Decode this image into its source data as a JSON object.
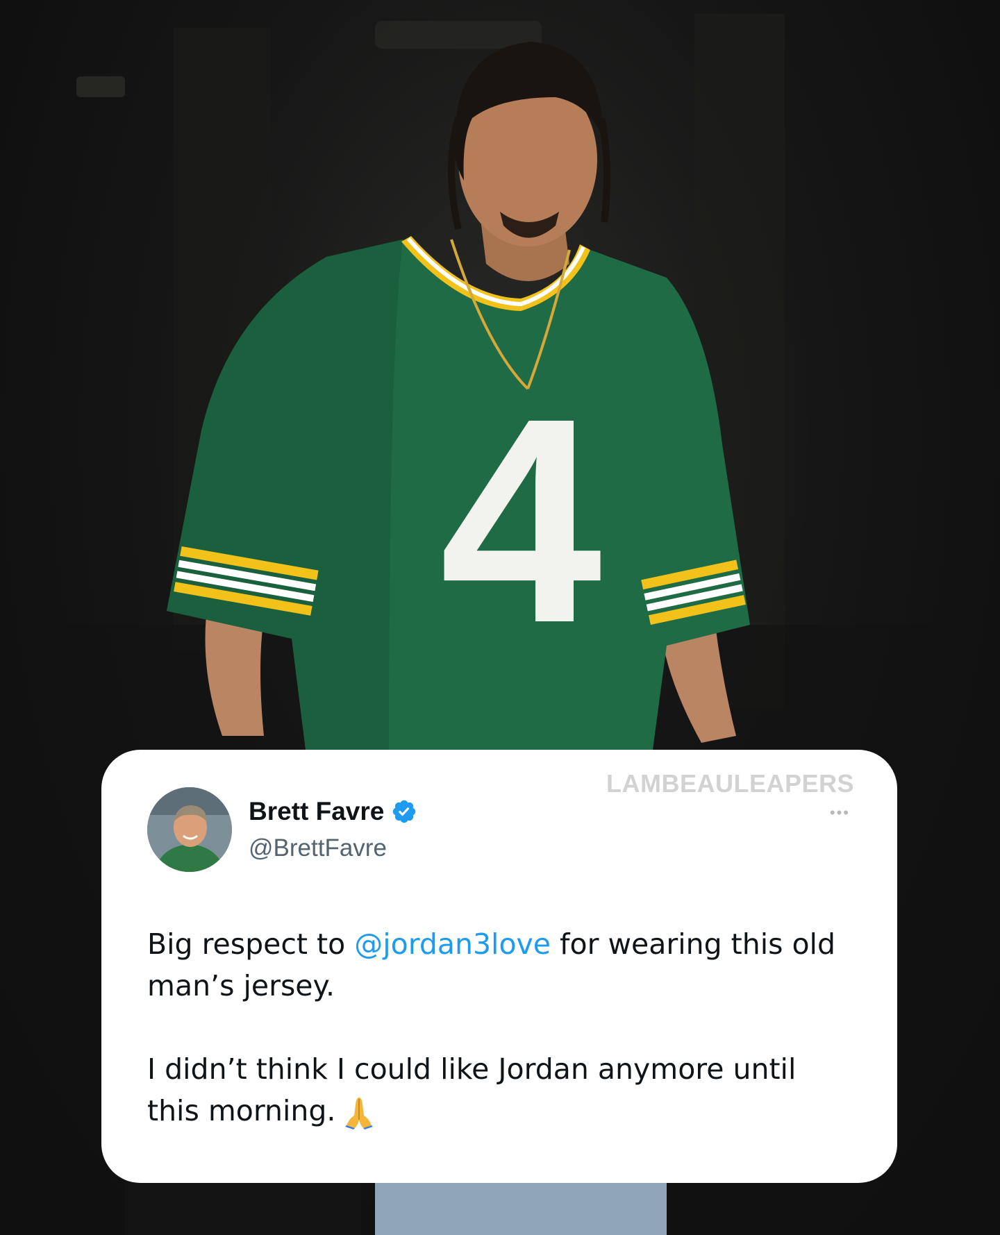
{
  "watermark": "LAMBEAULEAPERS",
  "more_glyph": "•••",
  "tweet": {
    "author_name": "Brett Favre",
    "handle": "@BrettFavre",
    "para1_before": "Big respect to ",
    "mention": "@jordan3love",
    "para1_after": " for wearing this old man’s jersey.",
    "para2": "I didn’t think I could like Jordan anymore until this morning."
  },
  "jersey": {
    "number": "4"
  },
  "colors": {
    "jersey_green": "#1e6b45",
    "jersey_gold": "#f2c21b",
    "link_blue": "#1d9bf0",
    "verified_blue": "#1d9bf0"
  },
  "icons": {
    "verified": "verified-badge-icon",
    "more": "more-dots-icon",
    "emoji": "folded-hands-icon"
  }
}
